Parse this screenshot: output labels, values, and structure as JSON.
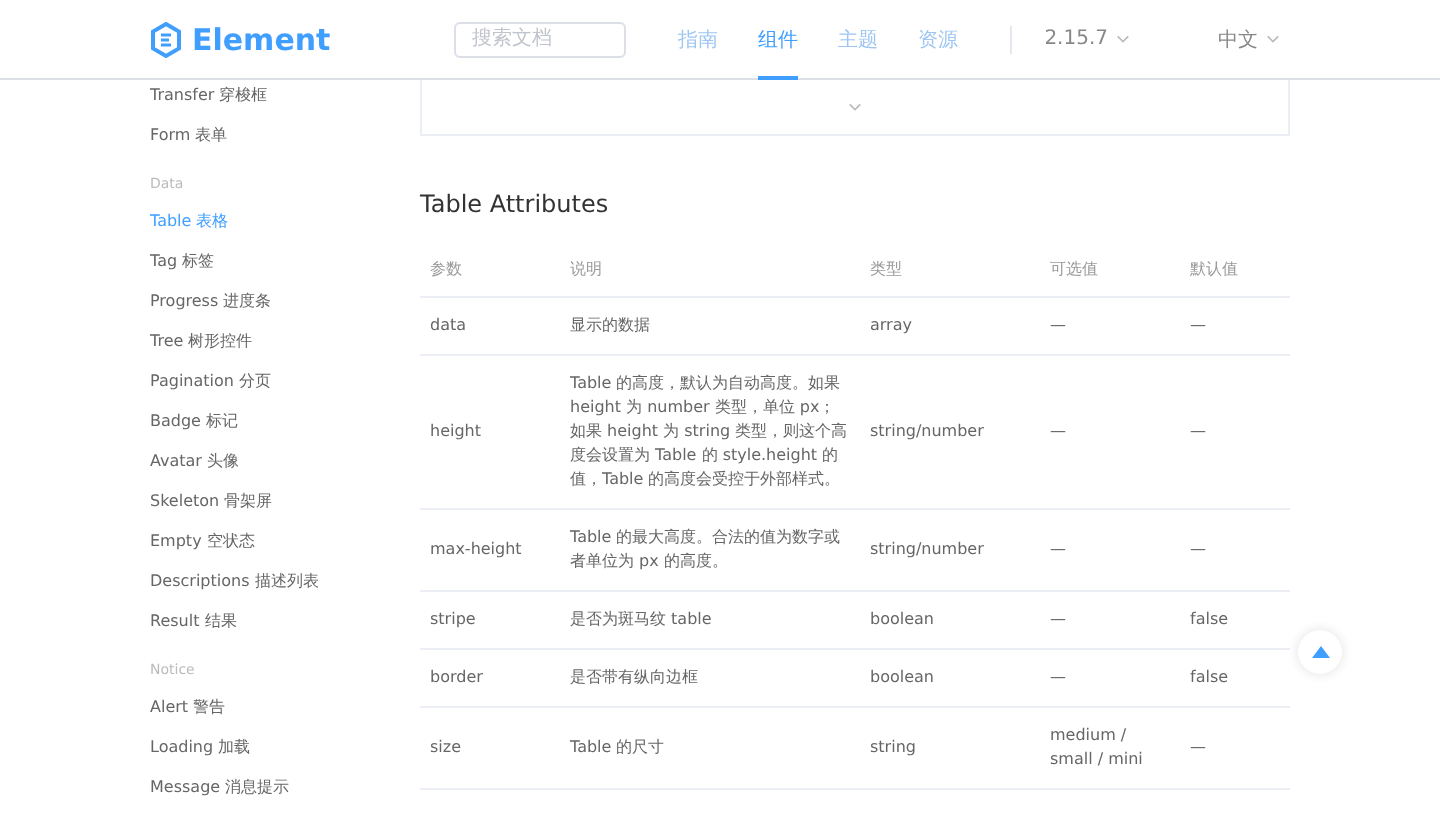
{
  "header": {
    "logo": "Element",
    "search": {
      "placeholder": "搜索文档"
    },
    "nav": [
      {
        "label": "指南",
        "selected": false
      },
      {
        "label": "组件",
        "selected": true
      },
      {
        "label": "主题",
        "selected": false
      },
      {
        "label": "资源",
        "selected": false
      }
    ],
    "version": "2.15.7",
    "language": "中文"
  },
  "sidebar": [
    {
      "kind": "item",
      "label": "Transfer 穿梭框",
      "selected": false
    },
    {
      "kind": "item",
      "label": "Form 表单",
      "selected": false
    },
    {
      "kind": "group",
      "label": "Data"
    },
    {
      "kind": "item",
      "label": "Table 表格",
      "selected": true
    },
    {
      "kind": "item",
      "label": "Tag 标签",
      "selected": false
    },
    {
      "kind": "item",
      "label": "Progress 进度条",
      "selected": false
    },
    {
      "kind": "item",
      "label": "Tree 树形控件",
      "selected": false
    },
    {
      "kind": "item",
      "label": "Pagination 分页",
      "selected": false
    },
    {
      "kind": "item",
      "label": "Badge 标记",
      "selected": false
    },
    {
      "kind": "item",
      "label": "Avatar 头像",
      "selected": false
    },
    {
      "kind": "item",
      "label": "Skeleton 骨架屏",
      "selected": false
    },
    {
      "kind": "item",
      "label": "Empty 空状态",
      "selected": false
    },
    {
      "kind": "item",
      "label": "Descriptions 描述列表",
      "selected": false
    },
    {
      "kind": "item",
      "label": "Result 结果",
      "selected": false
    },
    {
      "kind": "group",
      "label": "Notice"
    },
    {
      "kind": "item",
      "label": "Alert 警告",
      "selected": false
    },
    {
      "kind": "item",
      "label": "Loading 加载",
      "selected": false
    },
    {
      "kind": "item",
      "label": "Message 消息提示",
      "selected": false
    }
  ],
  "section_title": "Table Attributes",
  "table": {
    "columns": [
      "参数",
      "说明",
      "类型",
      "可选值",
      "默认值"
    ],
    "rows": [
      [
        "data",
        "显示的数据",
        "array",
        "—",
        "—"
      ],
      [
        "height",
        "Table 的高度，默认为自动高度。如果 height 为 number 类型，单位 px；如果 height 为 string 类型，则这个高度会设置为 Table 的 style.height 的值，Table 的高度会受控于外部样式。",
        "string/number",
        "—",
        "—"
      ],
      [
        "max-height",
        "Table 的最大高度。合法的值为数字或者单位为 px 的高度。",
        "string/number",
        "—",
        "—"
      ],
      [
        "stripe",
        "是否为斑马纹 table",
        "boolean",
        "—",
        "false"
      ],
      [
        "border",
        "是否带有纵向边框",
        "boolean",
        "—",
        "false"
      ],
      [
        "size",
        "Table 的尺寸",
        "string",
        "medium / small / mini",
        "—"
      ]
    ]
  }
}
